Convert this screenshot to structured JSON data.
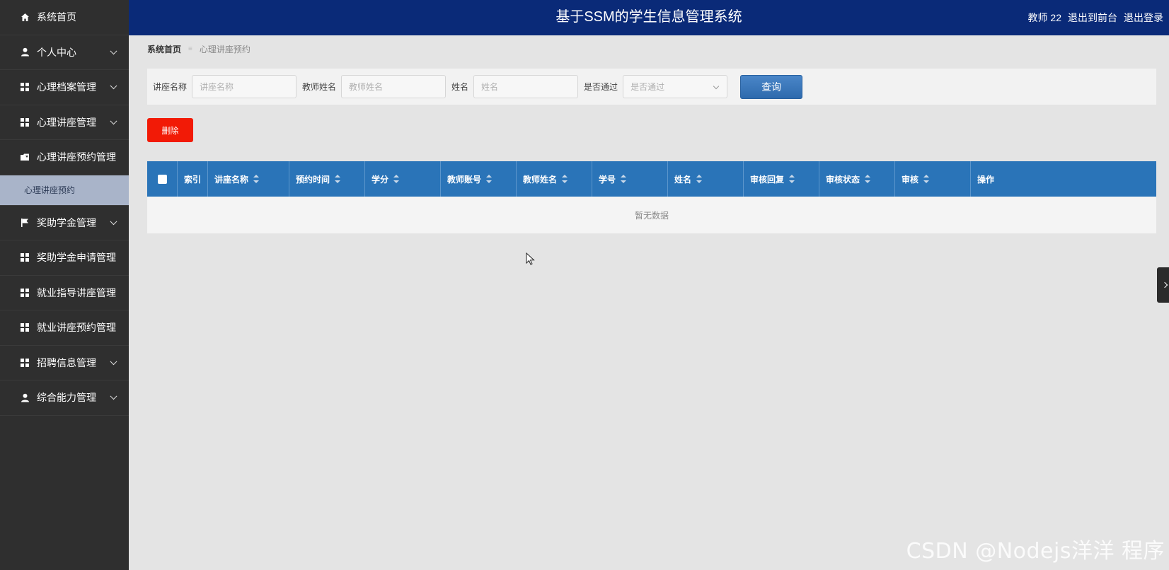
{
  "header": {
    "title": "基于SSM的学生信息管理系统",
    "user": "教师 22",
    "to_front": "退出到前台",
    "logout": "退出登录",
    "bg_color": "#0a2a78"
  },
  "sidebar": {
    "items": [
      {
        "label": "系统首页",
        "icon": "home-icon",
        "expandable": false
      },
      {
        "label": "个人中心",
        "icon": "user-icon",
        "expandable": true
      },
      {
        "label": "心理档案管理",
        "icon": "grid-icon",
        "expandable": true
      },
      {
        "label": "心理讲座管理",
        "icon": "grid-icon",
        "expandable": true
      },
      {
        "label": "心理讲座预约管理",
        "icon": "folder-icon",
        "expandable": false,
        "sub": "心理讲座预约"
      },
      {
        "label": "奖助学金管理",
        "icon": "flag-icon",
        "expandable": true
      },
      {
        "label": "奖助学金申请管理",
        "icon": "grid-icon",
        "expandable": false
      },
      {
        "label": "就业指导讲座管理",
        "icon": "grid-icon",
        "expandable": false
      },
      {
        "label": "就业讲座预约管理",
        "icon": "grid-icon",
        "expandable": false
      },
      {
        "label": "招聘信息管理",
        "icon": "grid-icon",
        "expandable": true
      },
      {
        "label": "综合能力管理",
        "icon": "user-icon",
        "expandable": true
      }
    ]
  },
  "breadcrumb": {
    "home": "系统首页",
    "separator": "≡",
    "current": "心理讲座预约"
  },
  "search": {
    "lecture_label": "讲座名称",
    "lecture_placeholder": "讲座名称",
    "teacher_label": "教师姓名",
    "teacher_placeholder": "教师姓名",
    "name_label": "姓名",
    "name_placeholder": "姓名",
    "passed_label": "是否通过",
    "passed_value": "是否通过",
    "query_button": "查询"
  },
  "actions": {
    "delete_button": "删除",
    "delete_color": "#f21a06"
  },
  "table": {
    "columns": [
      {
        "label": "索引",
        "sortable": false
      },
      {
        "label": "讲座名称",
        "sortable": true
      },
      {
        "label": "预约时间",
        "sortable": true
      },
      {
        "label": "学分",
        "sortable": true
      },
      {
        "label": "教师账号",
        "sortable": true
      },
      {
        "label": "教师姓名",
        "sortable": true
      },
      {
        "label": "学号",
        "sortable": true
      },
      {
        "label": "姓名",
        "sortable": true
      },
      {
        "label": "审核回复",
        "sortable": true
      },
      {
        "label": "审核状态",
        "sortable": true
      },
      {
        "label": "审核",
        "sortable": true
      },
      {
        "label": "操作",
        "sortable": false
      }
    ],
    "empty_text": "暂无数据",
    "header_color": "#2a74b8"
  },
  "watermark": "CSDN @Nodejs洋洋  程序"
}
